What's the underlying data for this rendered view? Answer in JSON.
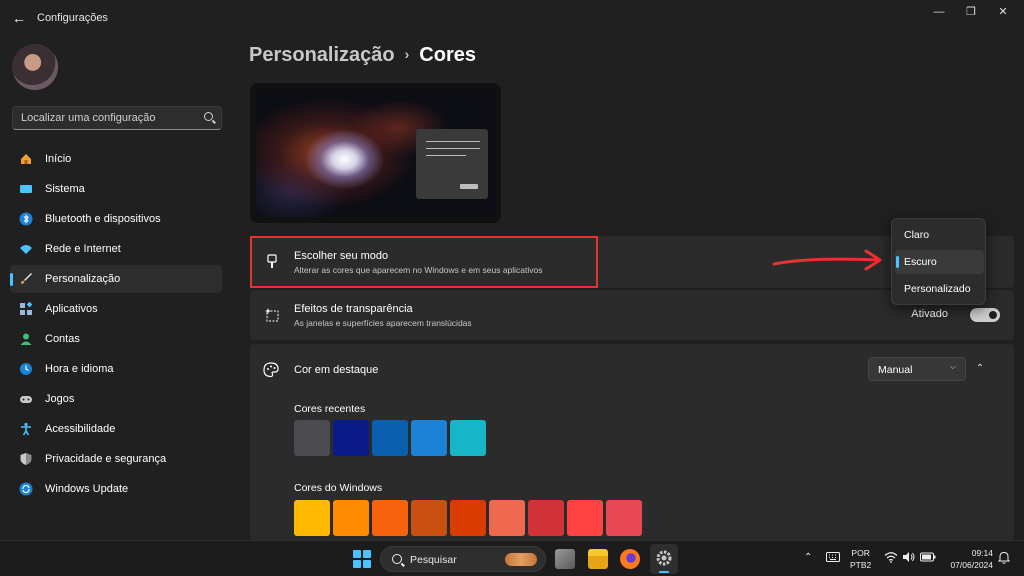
{
  "window": {
    "title": "Configurações",
    "back_glyph": "←",
    "minimize_glyph": "—",
    "maximize_glyph": "❐",
    "close_glyph": "✕"
  },
  "sidebar": {
    "search_placeholder": "Localizar uma configuração",
    "items": [
      {
        "label": "Início",
        "icon": "home-icon",
        "color": "#f0a030"
      },
      {
        "label": "Sistema",
        "icon": "system-icon",
        "color": "#4cc2ff"
      },
      {
        "label": "Bluetooth e dispositivos",
        "icon": "bluetooth-icon",
        "color": "#4cc2ff"
      },
      {
        "label": "Rede e Internet",
        "icon": "wifi-icon",
        "color": "#4cc2ff"
      },
      {
        "label": "Personalização",
        "icon": "brush-icon",
        "color": "#e89a5a",
        "active": true
      },
      {
        "label": "Aplicativos",
        "icon": "apps-icon",
        "color": "#9ab8d8"
      },
      {
        "label": "Contas",
        "icon": "account-icon",
        "color": "#3ac27a"
      },
      {
        "label": "Hora e idioma",
        "icon": "clock-globe-icon",
        "color": "#4cc2ff"
      },
      {
        "label": "Jogos",
        "icon": "gamepad-icon",
        "color": "#c8c8c8"
      },
      {
        "label": "Acessibilidade",
        "icon": "accessibility-icon",
        "color": "#4cc2ff"
      },
      {
        "label": "Privacidade e segurança",
        "icon": "shield-icon",
        "color": "#a8a8a8"
      },
      {
        "label": "Windows Update",
        "icon": "update-icon",
        "color": "#4cc2ff"
      }
    ]
  },
  "main": {
    "breadcrumb_parent": "Personalização",
    "breadcrumb_sep": "›",
    "breadcrumb_current": "Cores",
    "mode": {
      "title": "Escolher seu modo",
      "subtitle": "Alterar as cores que aparecem no Windows e em seus aplicativos"
    },
    "transparency": {
      "title": "Efeitos de transparência",
      "subtitle": "As janelas e superfícies aparecem translúcidas",
      "state": "Ativado"
    },
    "accent": {
      "title": "Cor em destaque",
      "value": "Manual",
      "recent_label": "Cores recentes",
      "recent_colors": [
        "#4a4a4f",
        "#0a1a8a",
        "#0a5fae",
        "#1a83d8",
        "#16b6c8"
      ],
      "windows_label": "Cores do Windows",
      "windows_colors": [
        "#ffb900",
        "#ff8c00",
        "#f7630c",
        "#ca5010",
        "#da3b01",
        "#ef6950",
        "#d13438",
        "#ff4343",
        "#e74856"
      ]
    }
  },
  "flyout": {
    "options": [
      "Claro",
      "Escuro",
      "Personalizado"
    ],
    "selected": "Escuro"
  },
  "taskbar": {
    "search_placeholder": "Pesquisar",
    "lang_line1": "POR",
    "lang_line2": "PTB2",
    "time": "09:14",
    "date": "07/06/2024"
  },
  "colors": {
    "accent": "#4cc2ff",
    "highlight": "#e8322f"
  }
}
